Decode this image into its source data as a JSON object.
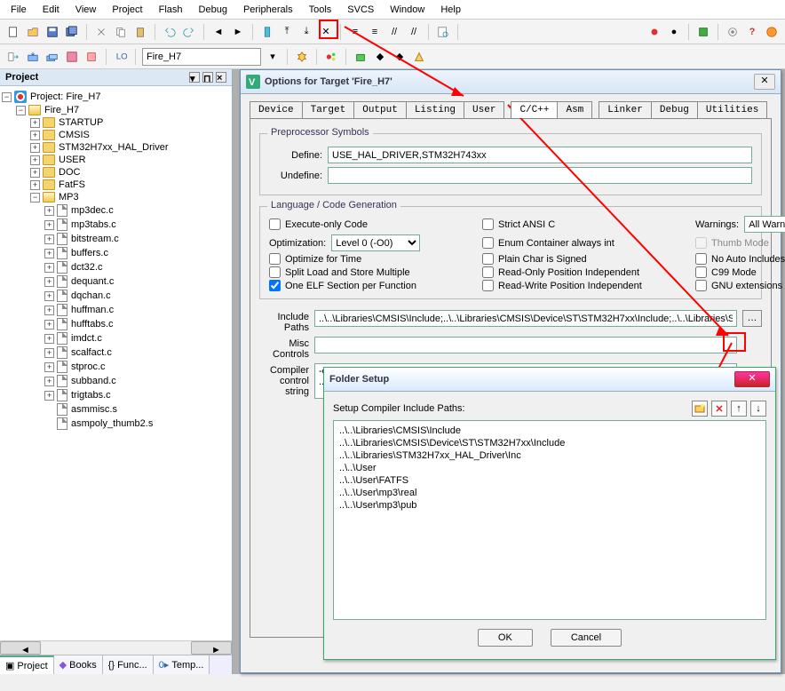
{
  "menubar": [
    "File",
    "Edit",
    "View",
    "Project",
    "Flash",
    "Debug",
    "Peripherals",
    "Tools",
    "SVCS",
    "Window",
    "Help"
  ],
  "toolbar2": {
    "target": "Fire_H7"
  },
  "project_panel": {
    "title": "Project",
    "root": "Project: Fire_H7",
    "target": "Fire_H7",
    "groups": [
      "STARTUP",
      "CMSIS",
      "STM32H7xx_HAL_Driver",
      "USER",
      "DOC",
      "FatFS"
    ],
    "mp3_group": "MP3",
    "mp3_files": [
      "mp3dec.c",
      "mp3tabs.c",
      "bitstream.c",
      "buffers.c",
      "dct32.c",
      "dequant.c",
      "dqchan.c",
      "huffman.c",
      "hufftabs.c",
      "imdct.c",
      "scalfact.c",
      "stproc.c",
      "subband.c",
      "trigtabs.c",
      "asmmisc.s",
      "asmpoly_thumb2.s"
    ],
    "tabs": [
      "Project",
      "Books",
      "Func...",
      "Temp..."
    ]
  },
  "options_dialog": {
    "title": "Options for Target 'Fire_H7'",
    "tabs": [
      "Device",
      "Target",
      "Output",
      "Listing",
      "User",
      "C/C++",
      "Asm",
      "Linker",
      "Debug",
      "Utilities"
    ],
    "active_tab": "C/C++",
    "preproc": {
      "legend": "Preprocessor Symbols",
      "define_label": "Define:",
      "define_value": "USE_HAL_DRIVER,STM32H743xx",
      "undefine_label": "Undefine:",
      "undefine_value": ""
    },
    "codegen": {
      "legend": "Language / Code Generation",
      "execute_only": "Execute-only Code",
      "optimization_label": "Optimization:",
      "optimization_value": "Level 0 (-O0)",
      "optimize_time": "Optimize for Time",
      "split_ls": "Split Load and Store Multiple",
      "one_elf": "One ELF Section per Function",
      "strict_ansi": "Strict ANSI C",
      "enum_int": "Enum Container always int",
      "plain_char": "Plain Char is Signed",
      "ro_pos": "Read-Only Position Independent",
      "rw_pos": "Read-Write Position Independent",
      "warnings_label": "Warnings:",
      "warnings_value": "All Warnings",
      "thumb": "Thumb Mode",
      "no_auto": "No Auto Includes",
      "c99": "C99 Mode",
      "gnu": "GNU extensions"
    },
    "include": {
      "label": "Include Paths",
      "value": "..\\..\\Libraries\\CMSIS\\Include;..\\..\\Libraries\\CMSIS\\Device\\ST\\STM32H7xx\\Include;..\\..\\Libraries\\S"
    },
    "misc": {
      "label": "Misc Controls",
      "value": ""
    },
    "compiler": {
      "label": "Compiler control string",
      "value": "-c --cpu\n../.."
    }
  },
  "folder_dialog": {
    "title": "Folder Setup",
    "heading": "Setup Compiler Include Paths:",
    "paths": [
      "..\\..\\Libraries\\CMSIS\\Include",
      "..\\..\\Libraries\\CMSIS\\Device\\ST\\STM32H7xx\\Include",
      "..\\..\\Libraries\\STM32H7xx_HAL_Driver\\Inc",
      "..\\..\\User",
      "..\\..\\User\\FATFS",
      "..\\..\\User\\mp3\\real",
      "..\\..\\User\\mp3\\pub"
    ],
    "ok": "OK",
    "cancel": "Cancel"
  }
}
